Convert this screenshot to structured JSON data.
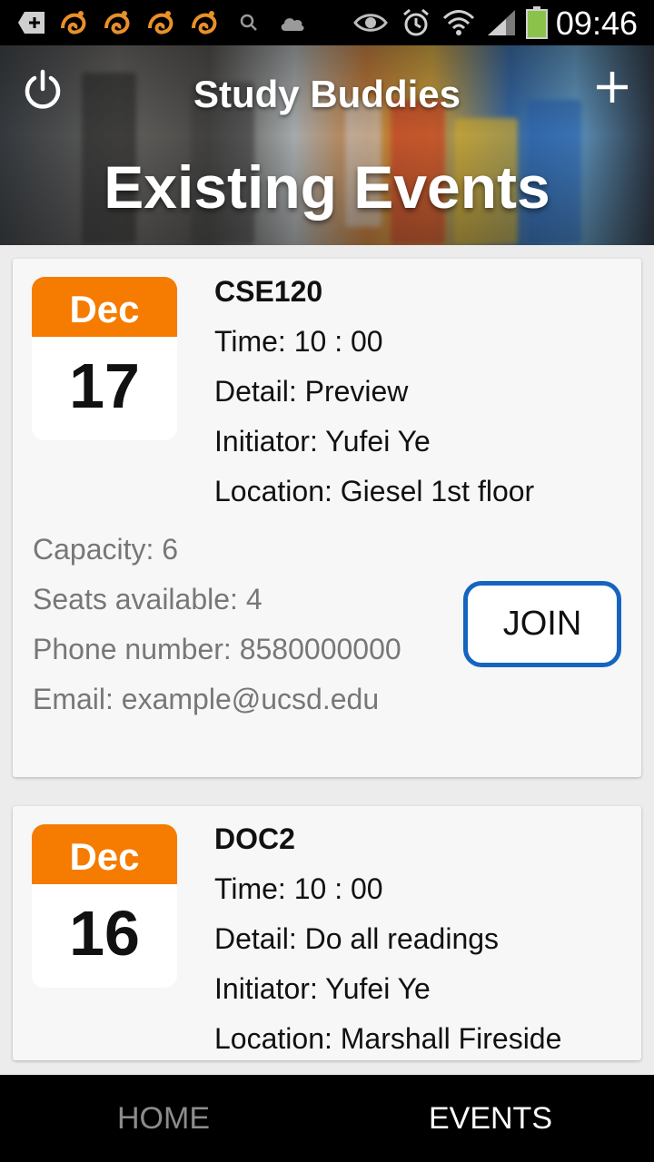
{
  "status_bar": {
    "time": "09:46",
    "icons": [
      "add-notification-icon",
      "uc-browser-icon",
      "uc-browser-icon",
      "uc-browser-icon",
      "uc-browser-icon",
      "search-icon",
      "cloud-icon",
      "eye-icon",
      "alarm-icon",
      "wifi-icon",
      "signal-icon",
      "battery-icon"
    ]
  },
  "header": {
    "app_title": "Study Buddies",
    "page_title": "Existing Events",
    "power_icon": "power-icon",
    "add_icon": "plus-icon"
  },
  "events": [
    {
      "month": "Dec",
      "day": "17",
      "course": "CSE120",
      "time": "Time: 10 : 00",
      "detail": "Detail: Preview",
      "initiator": "Initiator: Yufei Ye",
      "location": "Location: Giesel 1st floor",
      "capacity": "Capacity: 6",
      "seats": "Seats available: 4",
      "phone": "Phone number: 8580000000",
      "email": "Email: example@ucsd.edu",
      "join_label": "JOIN"
    },
    {
      "month": "Dec",
      "day": "16",
      "course": "DOC2",
      "time": "Time: 10 : 00",
      "detail": "Detail: Do all readings",
      "initiator": "Initiator: Yufei Ye",
      "location": "Location: Marshall Fireside"
    }
  ],
  "bottom_nav": {
    "home": "HOME",
    "events": "EVENTS",
    "active": "EVENTS"
  },
  "colors": {
    "month_badge": "#f57c00",
    "join_border": "#1565c0",
    "secondary_text": "#777777"
  }
}
